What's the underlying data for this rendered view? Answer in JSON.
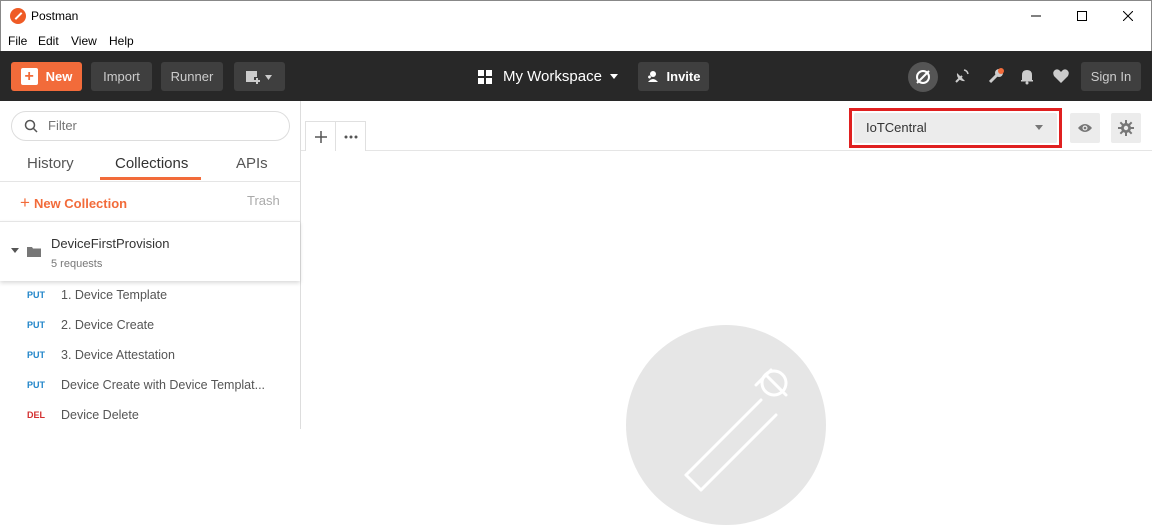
{
  "window": {
    "title": "Postman"
  },
  "menu": [
    "File",
    "Edit",
    "View",
    "Help"
  ],
  "header": {
    "new_label": "New",
    "import_label": "Import",
    "runner_label": "Runner",
    "workspace_label": "My Workspace",
    "invite_label": "Invite",
    "signin_label": "Sign In"
  },
  "sidebar": {
    "filter_placeholder": "Filter",
    "tabs": [
      "History",
      "Collections",
      "APIs"
    ],
    "active_tab": "Collections",
    "new_collection_label": "New Collection",
    "trash_label": "Trash",
    "collection": {
      "name": "DeviceFirstProvision",
      "count": "5 requests"
    },
    "requests": [
      {
        "method": "PUT",
        "name": "1. Device Template"
      },
      {
        "method": "PUT",
        "name": "2. Device Create"
      },
      {
        "method": "PUT",
        "name": "3. Device Attestation"
      },
      {
        "method": "PUT",
        "name": "Device Create with Device Templat..."
      },
      {
        "method": "DEL",
        "name": "Device Delete"
      }
    ]
  },
  "environment": {
    "selected": "IoTCentral"
  },
  "colors": {
    "accent": "#f26b3a",
    "header_bg": "#282828",
    "highlight": "#e02020"
  }
}
